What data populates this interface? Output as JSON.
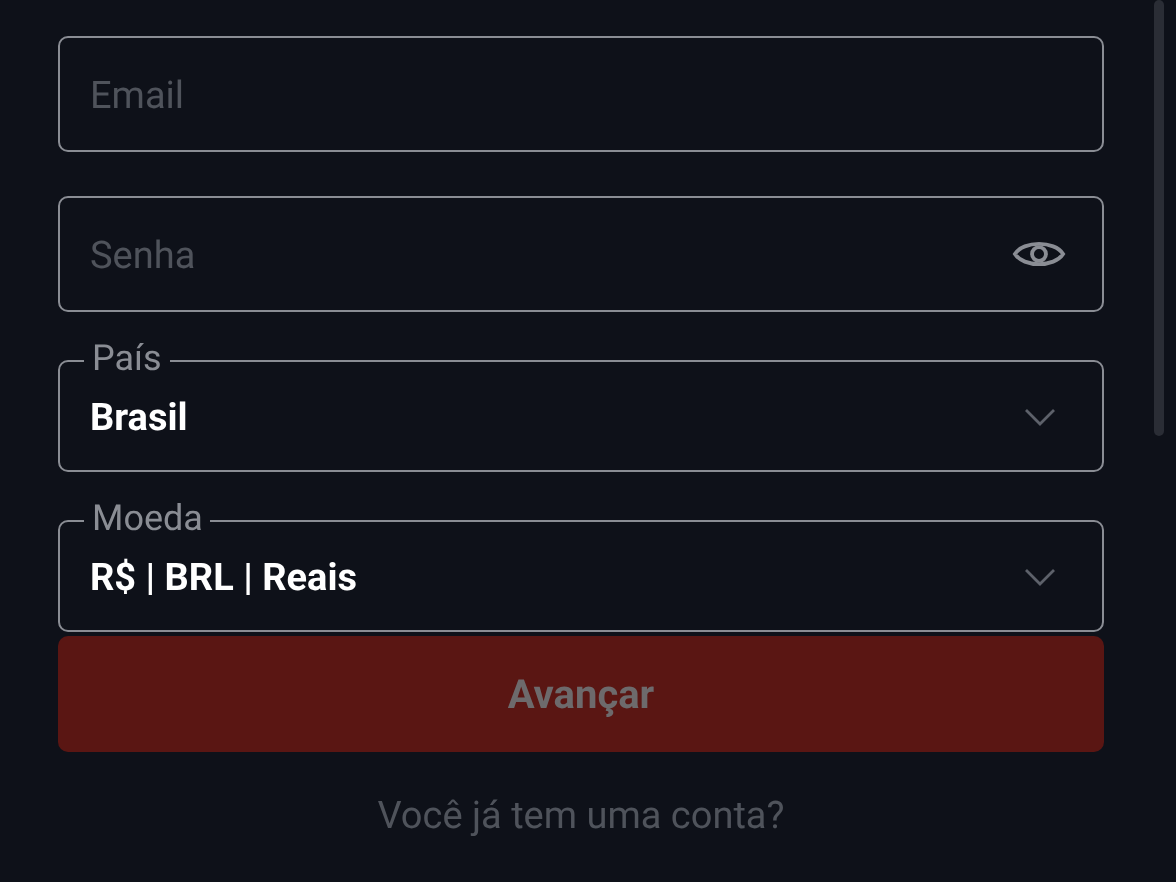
{
  "form": {
    "fields": [
      {
        "kind": "input",
        "placeholder": "Email",
        "secret": false
      },
      {
        "kind": "input",
        "placeholder": "Senha",
        "secret": true
      },
      {
        "kind": "select",
        "label": "País",
        "value": "Brasil"
      },
      {
        "kind": "select",
        "label": "Moeda",
        "value": "R$ | BRL | Reais"
      }
    ],
    "submit": {
      "label": "Avançar",
      "disabled": true
    },
    "footer_text": "Você já tem uma conta?"
  }
}
